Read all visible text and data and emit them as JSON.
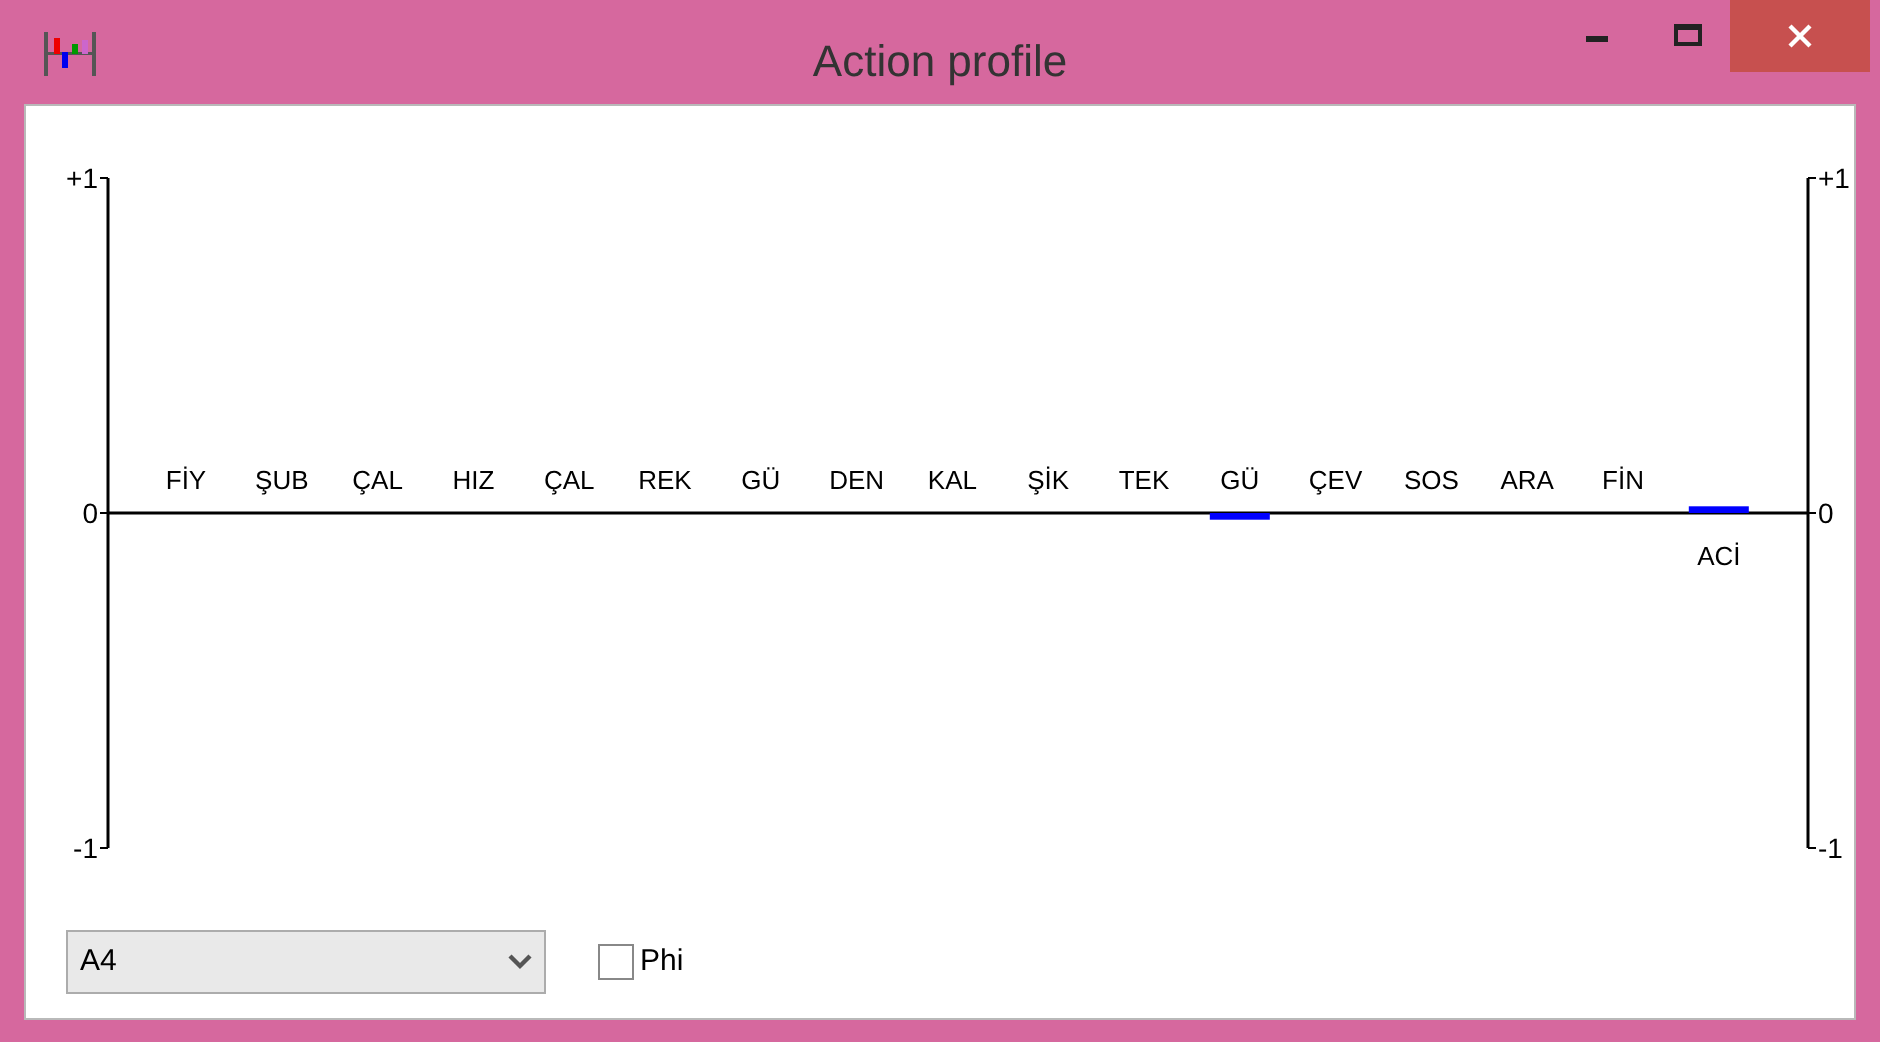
{
  "window": {
    "title": "Action profile"
  },
  "chart": {
    "chart_data": {
      "type": "bar",
      "categories": [
        "FİY",
        "ŞUB",
        "ÇAL",
        "HIZ",
        "ÇAL",
        "REK",
        "GÜ",
        "DEN",
        "KAL",
        "ŞİK",
        "TEK",
        "GÜ",
        "ÇEV",
        "SOS",
        "ARA",
        "FİN",
        "ACİ"
      ],
      "series": [
        {
          "color": "#0000ff",
          "values": [
            0,
            0,
            0,
            0,
            0,
            0,
            0,
            0,
            0,
            0,
            0,
            -0.02,
            0,
            0,
            0,
            0,
            0.02
          ]
        }
      ],
      "ylim": [
        -1,
        1
      ],
      "yticks": [
        {
          "value": 1,
          "label": "+1"
        },
        {
          "value": 0,
          "label": "0"
        },
        {
          "value": -1,
          "label": "-1"
        }
      ]
    }
  },
  "action_select": {
    "value": "A4"
  },
  "phi_checkbox": {
    "label": "Phi",
    "checked": false
  }
}
